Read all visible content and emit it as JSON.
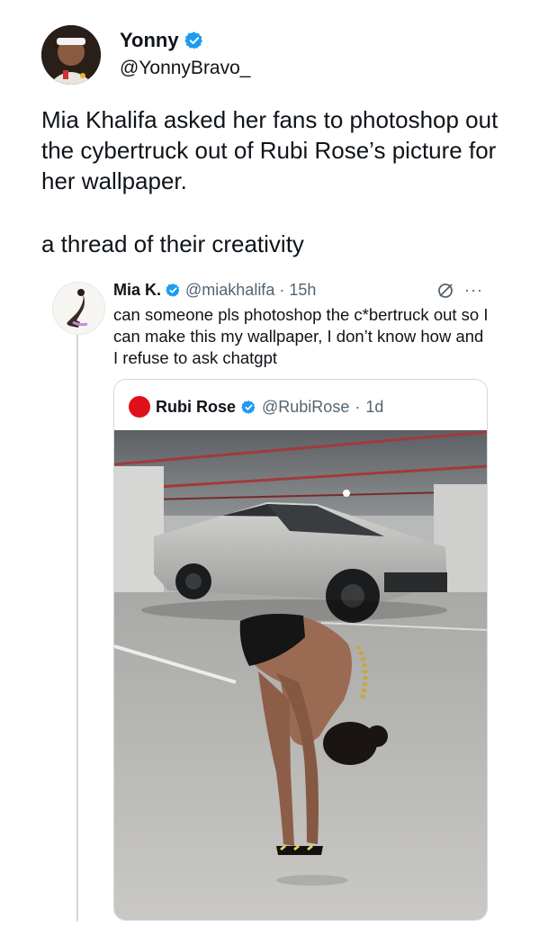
{
  "author": {
    "name": "Yonny",
    "handle": "@YonnyBravo_",
    "verified_color": "#1d9bf0"
  },
  "tweet": {
    "line1": "Mia Khalifa asked her fans to photoshop out the cybertruck out of Rubi Rose’s picture for her wallpaper.",
    "line2": "a thread of their creativity"
  },
  "quoted": {
    "name": "Mia K.",
    "handle": "@miakhalifa",
    "separator": "·",
    "time": "15h",
    "more": "···",
    "text": "can someone pls photoshop the c*bertruck out so I can make this my wallpaper, I don’t know how and I refuse to ask chatgpt",
    "inner": {
      "name": "Rubi Rose",
      "handle": "@RubiRose",
      "separator": "·",
      "time": "1d",
      "avatar_color": "#e0101a"
    }
  }
}
